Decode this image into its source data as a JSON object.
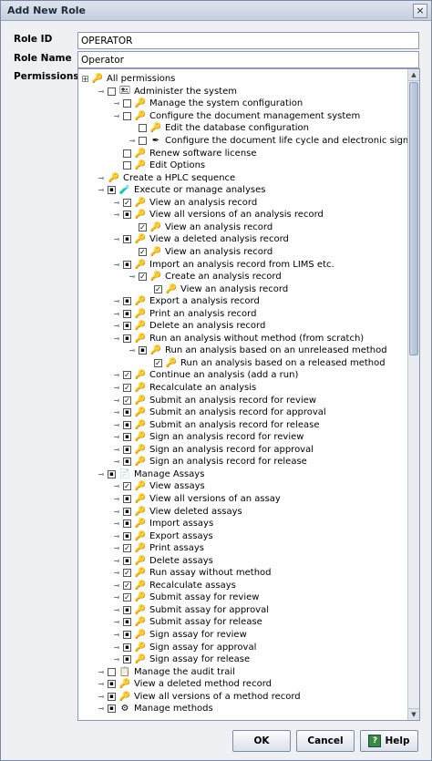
{
  "window": {
    "title": "Add New Role",
    "close_glyph": "×"
  },
  "form": {
    "role_id_label": "Role ID",
    "role_id_value": "OPERATOR",
    "role_name_label": "Role Name",
    "role_name_value": "Operator",
    "permissions_label": "Permissions"
  },
  "tree": [
    {
      "d": 0,
      "tg": "plus",
      "cb": "none",
      "icon": "key",
      "text": "All permissions"
    },
    {
      "d": 1,
      "tg": "open",
      "cb": "empty",
      "icon": "admin",
      "text": "Administer the system"
    },
    {
      "d": 2,
      "tg": "leaf",
      "cb": "empty",
      "icon": "key",
      "text": "Manage the system configuration"
    },
    {
      "d": 2,
      "tg": "open",
      "cb": "empty",
      "icon": "key",
      "text": "Configure the document management system"
    },
    {
      "d": 3,
      "tg": "none",
      "cb": "empty",
      "icon": "key",
      "text": "Edit the database configuration"
    },
    {
      "d": 3,
      "tg": "leaf",
      "cb": "empty",
      "icon": "pen",
      "text": "Configure the document life cycle and electronic signatures"
    },
    {
      "d": 2,
      "tg": "none",
      "cb": "empty",
      "icon": "key",
      "text": "Renew software license"
    },
    {
      "d": 2,
      "tg": "none",
      "cb": "empty",
      "icon": "key",
      "text": "Edit Options"
    },
    {
      "d": 1,
      "tg": "leaf",
      "cb": "none",
      "icon": "key",
      "text": "Create a HPLC sequence"
    },
    {
      "d": 1,
      "tg": "open",
      "cb": "plus",
      "icon": "analysis",
      "text": "Execute or manage analyses"
    },
    {
      "d": 2,
      "tg": "leaf",
      "cb": "checked",
      "icon": "key",
      "text": "View an analysis record"
    },
    {
      "d": 2,
      "tg": "open",
      "cb": "plus",
      "icon": "key",
      "text": "View all versions of an analysis record"
    },
    {
      "d": 3,
      "tg": "none",
      "cb": "checked",
      "icon": "key",
      "text": "View an analysis record"
    },
    {
      "d": 2,
      "tg": "open",
      "cb": "plus",
      "icon": "key",
      "text": "View a deleted analysis record"
    },
    {
      "d": 3,
      "tg": "none",
      "cb": "checked",
      "icon": "key",
      "text": "View an analysis record"
    },
    {
      "d": 2,
      "tg": "open",
      "cb": "plus",
      "icon": "key",
      "text": "Import an analysis record from LIMS etc."
    },
    {
      "d": 3,
      "tg": "open",
      "cb": "checked",
      "icon": "key",
      "text": "Create an analysis record"
    },
    {
      "d": 4,
      "tg": "none",
      "cb": "checked",
      "icon": "key",
      "text": "View an analysis record"
    },
    {
      "d": 2,
      "tg": "leaf",
      "cb": "plus",
      "icon": "key",
      "text": "Export a analysis record"
    },
    {
      "d": 2,
      "tg": "leaf",
      "cb": "plus",
      "icon": "key",
      "text": "Print an analysis record"
    },
    {
      "d": 2,
      "tg": "leaf",
      "cb": "plus",
      "icon": "key",
      "text": "Delete an analysis record"
    },
    {
      "d": 2,
      "tg": "open",
      "cb": "plus",
      "icon": "key",
      "text": "Run an analysis without method (from scratch)"
    },
    {
      "d": 3,
      "tg": "open",
      "cb": "plus",
      "icon": "key",
      "text": "Run an analysis based on an unreleased method"
    },
    {
      "d": 4,
      "tg": "none",
      "cb": "checked",
      "icon": "key",
      "text": "Run an analysis based on a released method"
    },
    {
      "d": 2,
      "tg": "leaf",
      "cb": "checked",
      "icon": "key",
      "text": "Continue an analysis (add a run)"
    },
    {
      "d": 2,
      "tg": "leaf",
      "cb": "checked",
      "icon": "key",
      "text": "Recalculate an analysis"
    },
    {
      "d": 2,
      "tg": "leaf",
      "cb": "checked",
      "icon": "key",
      "text": "Submit an analysis record for review"
    },
    {
      "d": 2,
      "tg": "leaf",
      "cb": "plus",
      "icon": "key",
      "text": "Submit an analysis record for approval"
    },
    {
      "d": 2,
      "tg": "leaf",
      "cb": "plus",
      "icon": "key",
      "text": "Submit an analysis record for release"
    },
    {
      "d": 2,
      "tg": "leaf",
      "cb": "plus",
      "icon": "key",
      "text": "Sign an analysis record for review"
    },
    {
      "d": 2,
      "tg": "leaf",
      "cb": "plus",
      "icon": "key",
      "text": "Sign an analysis record for approval"
    },
    {
      "d": 2,
      "tg": "leaf",
      "cb": "plus",
      "icon": "key",
      "text": "Sign an analysis record for release"
    },
    {
      "d": 1,
      "tg": "open",
      "cb": "plus",
      "icon": "doc",
      "text": "Manage Assays"
    },
    {
      "d": 2,
      "tg": "leaf",
      "cb": "checked",
      "icon": "key",
      "text": "View assays"
    },
    {
      "d": 2,
      "tg": "leaf",
      "cb": "plus",
      "icon": "key",
      "text": "View all versions of an assay"
    },
    {
      "d": 2,
      "tg": "leaf",
      "cb": "plus",
      "icon": "key",
      "text": "View deleted assays"
    },
    {
      "d": 2,
      "tg": "leaf",
      "cb": "plus",
      "icon": "key",
      "text": "Import assays"
    },
    {
      "d": 2,
      "tg": "leaf",
      "cb": "plus",
      "icon": "key",
      "text": "Export assays"
    },
    {
      "d": 2,
      "tg": "leaf",
      "cb": "checked",
      "icon": "key",
      "text": "Print assays"
    },
    {
      "d": 2,
      "tg": "leaf",
      "cb": "plus",
      "icon": "key",
      "text": "Delete assays"
    },
    {
      "d": 2,
      "tg": "leaf",
      "cb": "checked",
      "icon": "key",
      "text": "Run assay without method"
    },
    {
      "d": 2,
      "tg": "leaf",
      "cb": "checked",
      "icon": "key",
      "text": "Recalculate assays"
    },
    {
      "d": 2,
      "tg": "leaf",
      "cb": "checked",
      "icon": "key",
      "text": "Submit assay for review"
    },
    {
      "d": 2,
      "tg": "leaf",
      "cb": "plus",
      "icon": "key",
      "text": "Submit assay for approval"
    },
    {
      "d": 2,
      "tg": "leaf",
      "cb": "plus",
      "icon": "key",
      "text": "Submit assay for release"
    },
    {
      "d": 2,
      "tg": "leaf",
      "cb": "plus",
      "icon": "key",
      "text": "Sign assay for review"
    },
    {
      "d": 2,
      "tg": "leaf",
      "cb": "plus",
      "icon": "key",
      "text": "Sign assay for approval"
    },
    {
      "d": 2,
      "tg": "leaf",
      "cb": "plus",
      "icon": "key",
      "text": "Sign assay for release"
    },
    {
      "d": 1,
      "tg": "leaf",
      "cb": "empty",
      "icon": "trail",
      "text": "Manage the audit trail"
    },
    {
      "d": 1,
      "tg": "leaf",
      "cb": "plus",
      "icon": "key",
      "text": "View a deleted method record"
    },
    {
      "d": 1,
      "tg": "leaf",
      "cb": "plus",
      "icon": "key",
      "text": "View all versions of a method record"
    },
    {
      "d": 1,
      "tg": "leaf",
      "cb": "plus",
      "icon": "methods",
      "text": "Manage methods"
    }
  ],
  "buttons": {
    "ok": "OK",
    "cancel": "Cancel",
    "help": "Help"
  }
}
